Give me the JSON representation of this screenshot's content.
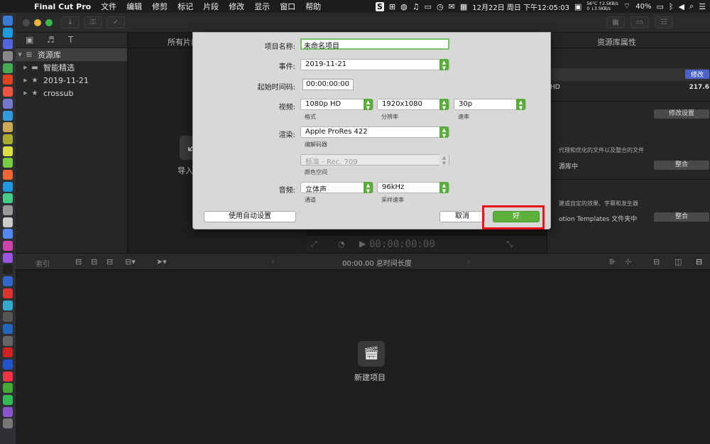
{
  "menubar": {
    "apple_glyph": "",
    "app_name": "Final Cut Pro",
    "items": [
      "文件",
      "编辑",
      "修剪",
      "标记",
      "片段",
      "修改",
      "显示",
      "窗口",
      "帮助"
    ],
    "status": {
      "sogou": "S",
      "temperature": "56°C",
      "cpu": "0",
      "net_up": "↑2.5KB/s",
      "net_down": "↓3.5KB/s",
      "datetime": "12月22日 周日 下午12:05:03",
      "battery": "40%"
    }
  },
  "dock": {
    "colors": [
      "#3a7bd5",
      "#1e9be0",
      "#5566dd",
      "#888888",
      "#44aa55",
      "#dd4422",
      "#ee5544",
      "#7777cc",
      "#3399dd",
      "#ccaa55",
      "#aaaa33",
      "#dddd44",
      "#77cc44",
      "#ee6633",
      "#2299dd",
      "#44cc88",
      "#999999",
      "#cccccc",
      "#5588ee",
      "#cc44aa",
      "#9955dd",
      "#222222",
      "#3366cc",
      "#dd3333",
      "#33aacc",
      "#555555",
      "#2266bb",
      "#666666",
      "#cc2222",
      "#2255cc",
      "#ee3344",
      "#44aa33",
      "#33bb55",
      "#8855cc",
      "#777777"
    ]
  },
  "library": {
    "tab_icons": [
      "camera-icon",
      "music-icon",
      "title-icon"
    ],
    "rows": [
      {
        "label": "资源库",
        "type": "library"
      },
      {
        "label": "智能精选",
        "type": "folder"
      },
      {
        "label": "2019-11-21",
        "type": "event"
      },
      {
        "label": "crossub",
        "type": "event"
      }
    ]
  },
  "browser": {
    "header": "所有片段",
    "import_label": "导入"
  },
  "inspector": {
    "title": "资源库属性",
    "band_right": "修改",
    "row2_left": "HD",
    "row2_right": "217.6",
    "modify_btn": "修改设置",
    "desc1": "代理和优化的文件以及整合的文件",
    "desc1b": "源库中",
    "consolidate_btn": "整合",
    "desc2": "建或自定的效果、字幕和发生器",
    "desc2b": "otion Templates 文件夹中",
    "consolidate_btn2": "整合"
  },
  "viewer": {
    "timecode": "00:00:00:00"
  },
  "timeline": {
    "index_label": "索引",
    "duration": "00:00.00 总时间长度",
    "new_project_label": "新建项目"
  },
  "dialog": {
    "name_label": "项目名称:",
    "name_value": "未命名项目",
    "event_label": "事件:",
    "event_value": "2019-11-21",
    "start_tc_label": "起始时间码:",
    "start_tc_value": "00:00:00:00",
    "video_label": "视频:",
    "format_value": "1080p HD",
    "format_caption": "格式",
    "resolution_value": "1920x1080",
    "resolution_caption": "分辨率",
    "rate_value": "30p",
    "rate_caption": "速率",
    "render_label": "渲染:",
    "codec_value": "Apple ProRes 422",
    "codec_caption": "编解码器",
    "colorspace_value": "标准 - Rec. 709",
    "colorspace_caption": "颜色空间",
    "audio_label": "音频:",
    "channels_value": "立体声",
    "channels_caption": "通道",
    "samplerate_value": "96kHz",
    "samplerate_caption": "采样速率",
    "auto_settings_button": "使用自动设置",
    "cancel_button": "取消",
    "ok_button": "好"
  },
  "annotation": {
    "highlight_color": "#e5141b"
  }
}
